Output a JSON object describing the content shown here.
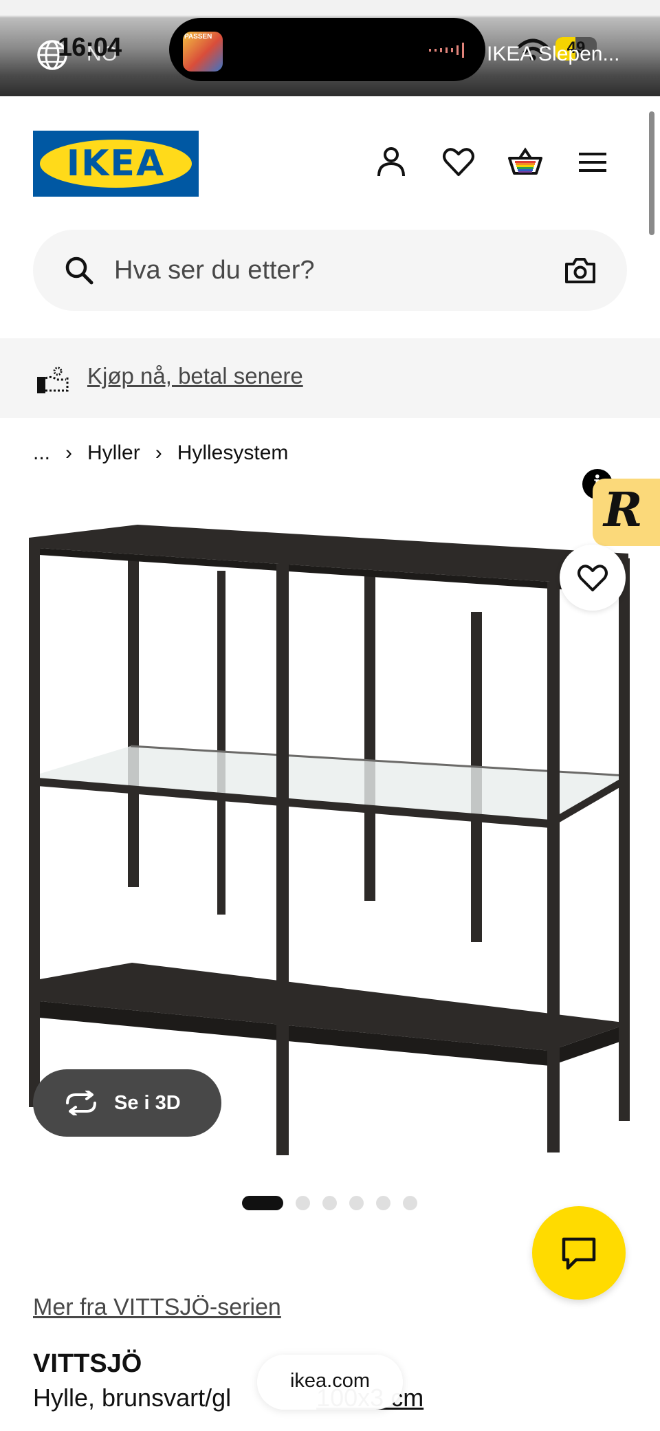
{
  "status_bar": {
    "time": "16:04",
    "region": "NO",
    "battery": "49",
    "tab_title": "IKEA Slepen...",
    "battery_level": 0.49
  },
  "header": {
    "logo_text": "IKEA",
    "icons": [
      "account-icon",
      "wishlist-icon",
      "cart-icon",
      "menu-icon"
    ]
  },
  "search": {
    "placeholder": "Hva ser du etter?"
  },
  "promo": {
    "text": "Kjøp nå, betal senere"
  },
  "breadcrumb": {
    "items": [
      "...",
      "Hyller",
      "Hyllesystem"
    ]
  },
  "product_image": {
    "view_3d_label": "Se i 3D",
    "dots_total": 6,
    "active_dot": 1
  },
  "product": {
    "series_link": "Mer fra VITTSJÖ-serien",
    "name": "VITTSJÖ",
    "description_prefix": "Hylle, brunsvart/gl",
    "description_dims": "100x3 cm"
  },
  "browser": {
    "url": "ikea.com"
  },
  "colors": {
    "ikea_blue": "#0058a3",
    "ikea_yellow": "#ffda1a",
    "chat_yellow": "#ffdb00",
    "text_dark": "#111111",
    "text_grey": "#484848"
  }
}
